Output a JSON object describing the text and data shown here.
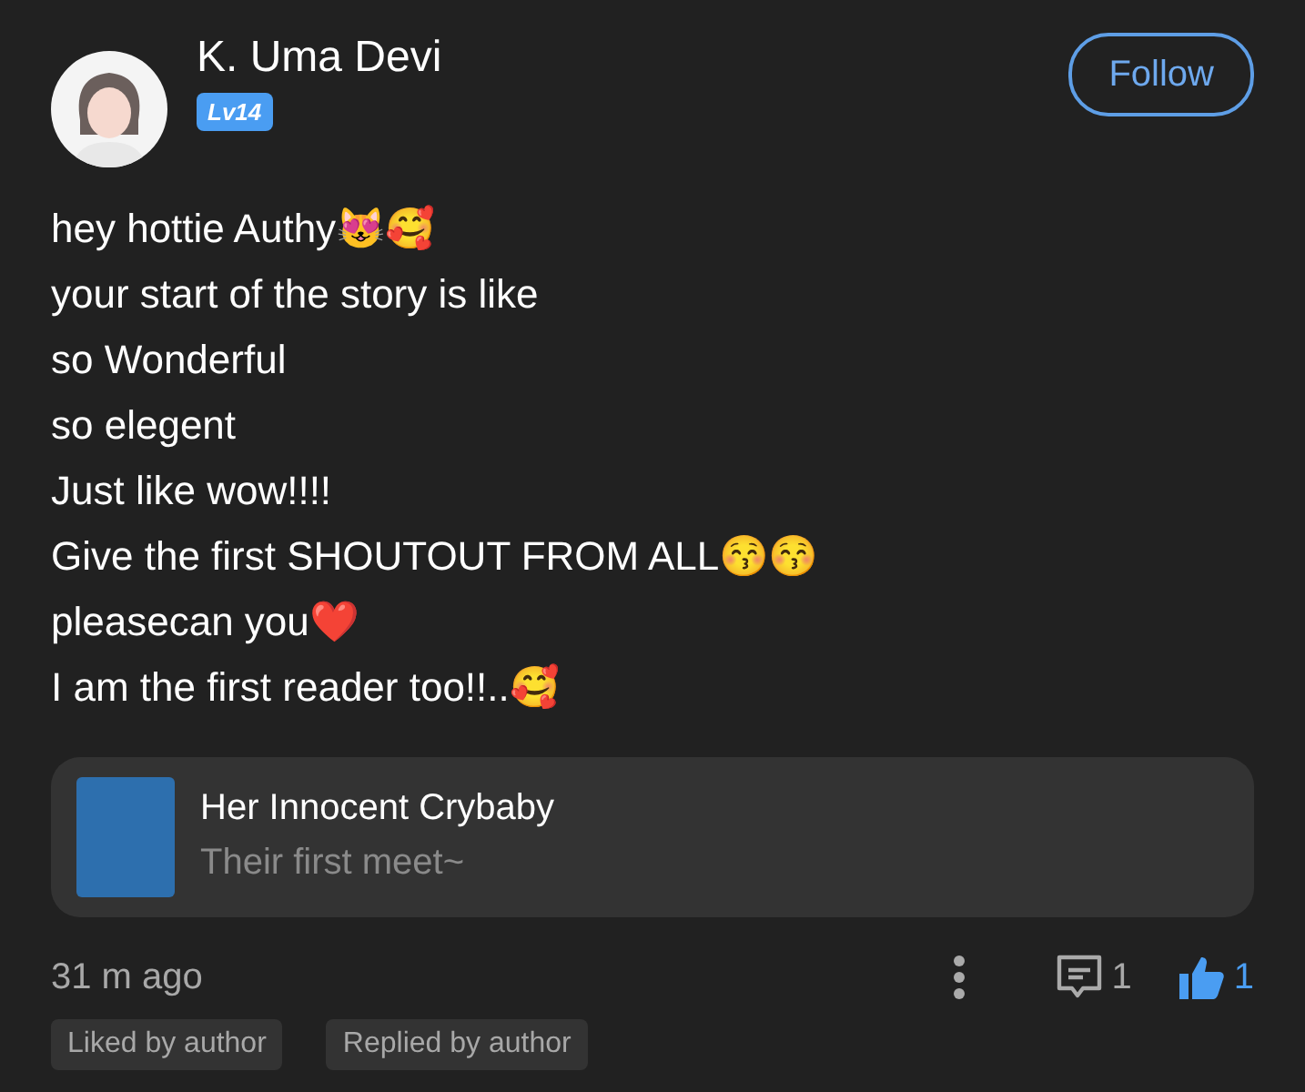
{
  "author": {
    "name": "K. Uma Devi",
    "level_badge": "Lv14"
  },
  "follow_button": {
    "label": "Follow",
    "following": false
  },
  "comment_lines": [
    "hey hottie Authy😻🥰",
    "your start of the story is like",
    "so Wonderful",
    "so elegent",
    "Just like wow!!!!",
    "Give the first SHOUTOUT FROM ALL😚😚",
    "pleasecan you❤️",
    "I am the first reader too!!..🥰"
  ],
  "story_card": {
    "title": "Her Innocent Crybaby",
    "subtitle": "Their first meet~"
  },
  "footer": {
    "time": "31 m ago",
    "reply_count": "1",
    "like_count": "1",
    "liked": true
  },
  "tags": [
    "Liked by author",
    "Replied by author"
  ]
}
